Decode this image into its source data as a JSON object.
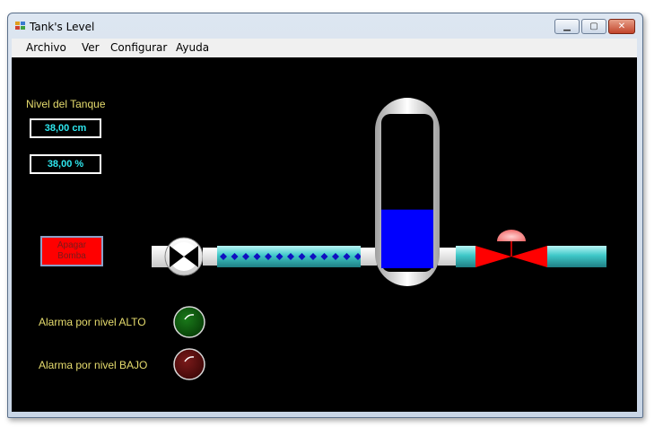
{
  "window": {
    "title": "Tank's Level"
  },
  "menu": [
    {
      "label": "Archivo"
    },
    {
      "label": "Ver"
    },
    {
      "label": "Configurar"
    },
    {
      "label": "Ayuda"
    }
  ],
  "panel": {
    "title": "Nivel del Tanque",
    "level_cm": "38,00 cm",
    "level_pct": "38,00 %",
    "pump_button": {
      "line1": "Apagar",
      "line2": "Bomba"
    },
    "alarm_high": {
      "label": "Alarma por nivel ALTO",
      "color": "#0a5a0a"
    },
    "alarm_low": {
      "label": "Alarma por nivel BAJO",
      "color": "#5a0a0a"
    }
  },
  "tank": {
    "fill_fraction": 0.38,
    "liquid_color": "#0000ff"
  },
  "colors": {
    "pipe": "#3ec8c8",
    "valve": "#ff0000",
    "accent_text": "#e6dc6e",
    "readout_text": "#2ee6ee"
  }
}
